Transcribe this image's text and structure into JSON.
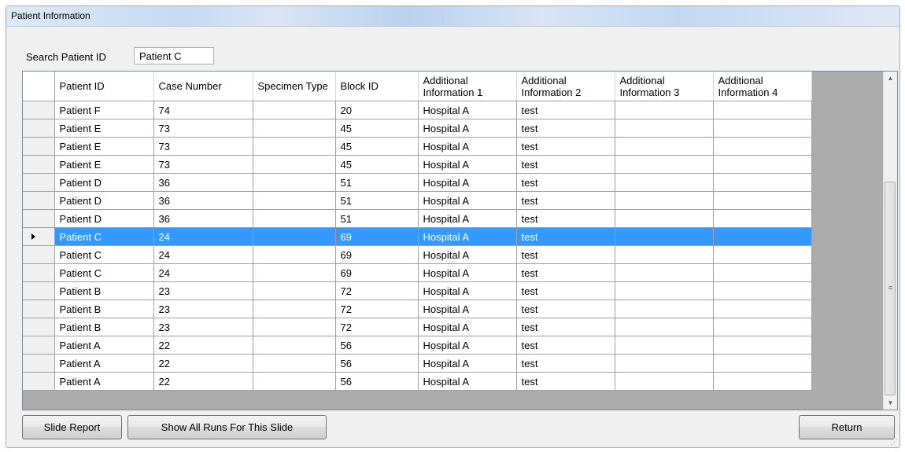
{
  "window": {
    "title": "Patient Information"
  },
  "search": {
    "label": "Search Patient ID",
    "value": "Patient C"
  },
  "grid": {
    "columns": [
      "Patient ID",
      "Case Number",
      "Specimen Type",
      "Block ID",
      "Additional Information 1",
      "Additional Information 2",
      "Additional Information 3",
      "Additional Information 4"
    ],
    "selected_row_index": 7,
    "rows": [
      [
        "Patient F",
        "74",
        "",
        "20",
        "Hospital A",
        "test",
        "",
        ""
      ],
      [
        "Patient E",
        "73",
        "",
        "45",
        "Hospital A",
        "test",
        "",
        ""
      ],
      [
        "Patient E",
        "73",
        "",
        "45",
        "Hospital A",
        "test",
        "",
        ""
      ],
      [
        "Patient E",
        "73",
        "",
        "45",
        "Hospital A",
        "test",
        "",
        ""
      ],
      [
        "Patient D",
        "36",
        "",
        "51",
        "Hospital A",
        "test",
        "",
        ""
      ],
      [
        "Patient D",
        "36",
        "",
        "51",
        "Hospital A",
        "test",
        "",
        ""
      ],
      [
        "Patient D",
        "36",
        "",
        "51",
        "Hospital A",
        "test",
        "",
        ""
      ],
      [
        "Patient C",
        "24",
        "",
        "69",
        "Hospital A",
        "test",
        "",
        ""
      ],
      [
        "Patient C",
        "24",
        "",
        "69",
        "Hospital A",
        "test",
        "",
        ""
      ],
      [
        "Patient C",
        "24",
        "",
        "69",
        "Hospital A",
        "test",
        "",
        ""
      ],
      [
        "Patient B",
        "23",
        "",
        "72",
        "Hospital A",
        "test",
        "",
        ""
      ],
      [
        "Patient B",
        "23",
        "",
        "72",
        "Hospital A",
        "test",
        "",
        ""
      ],
      [
        "Patient B",
        "23",
        "",
        "72",
        "Hospital A",
        "test",
        "",
        ""
      ],
      [
        "Patient A",
        "22",
        "",
        "56",
        "Hospital A",
        "test",
        "",
        ""
      ],
      [
        "Patient A",
        "22",
        "",
        "56",
        "Hospital A",
        "test",
        "",
        ""
      ],
      [
        "Patient A",
        "22",
        "",
        "56",
        "Hospital A",
        "test",
        "",
        ""
      ]
    ],
    "selection_color": "#3399ff"
  },
  "buttons": {
    "slide_report": "Slide Report",
    "show_all_runs": "Show All Runs For This Slide",
    "return": "Return"
  },
  "icons": {
    "row_indicator": "current-row-arrow-icon",
    "scroll_up": "scroll-up-arrow-icon",
    "scroll_down": "scroll-down-arrow-icon",
    "scroll_grip": "scroll-grip-icon",
    "resize_grip": "resize-grip-icon"
  }
}
